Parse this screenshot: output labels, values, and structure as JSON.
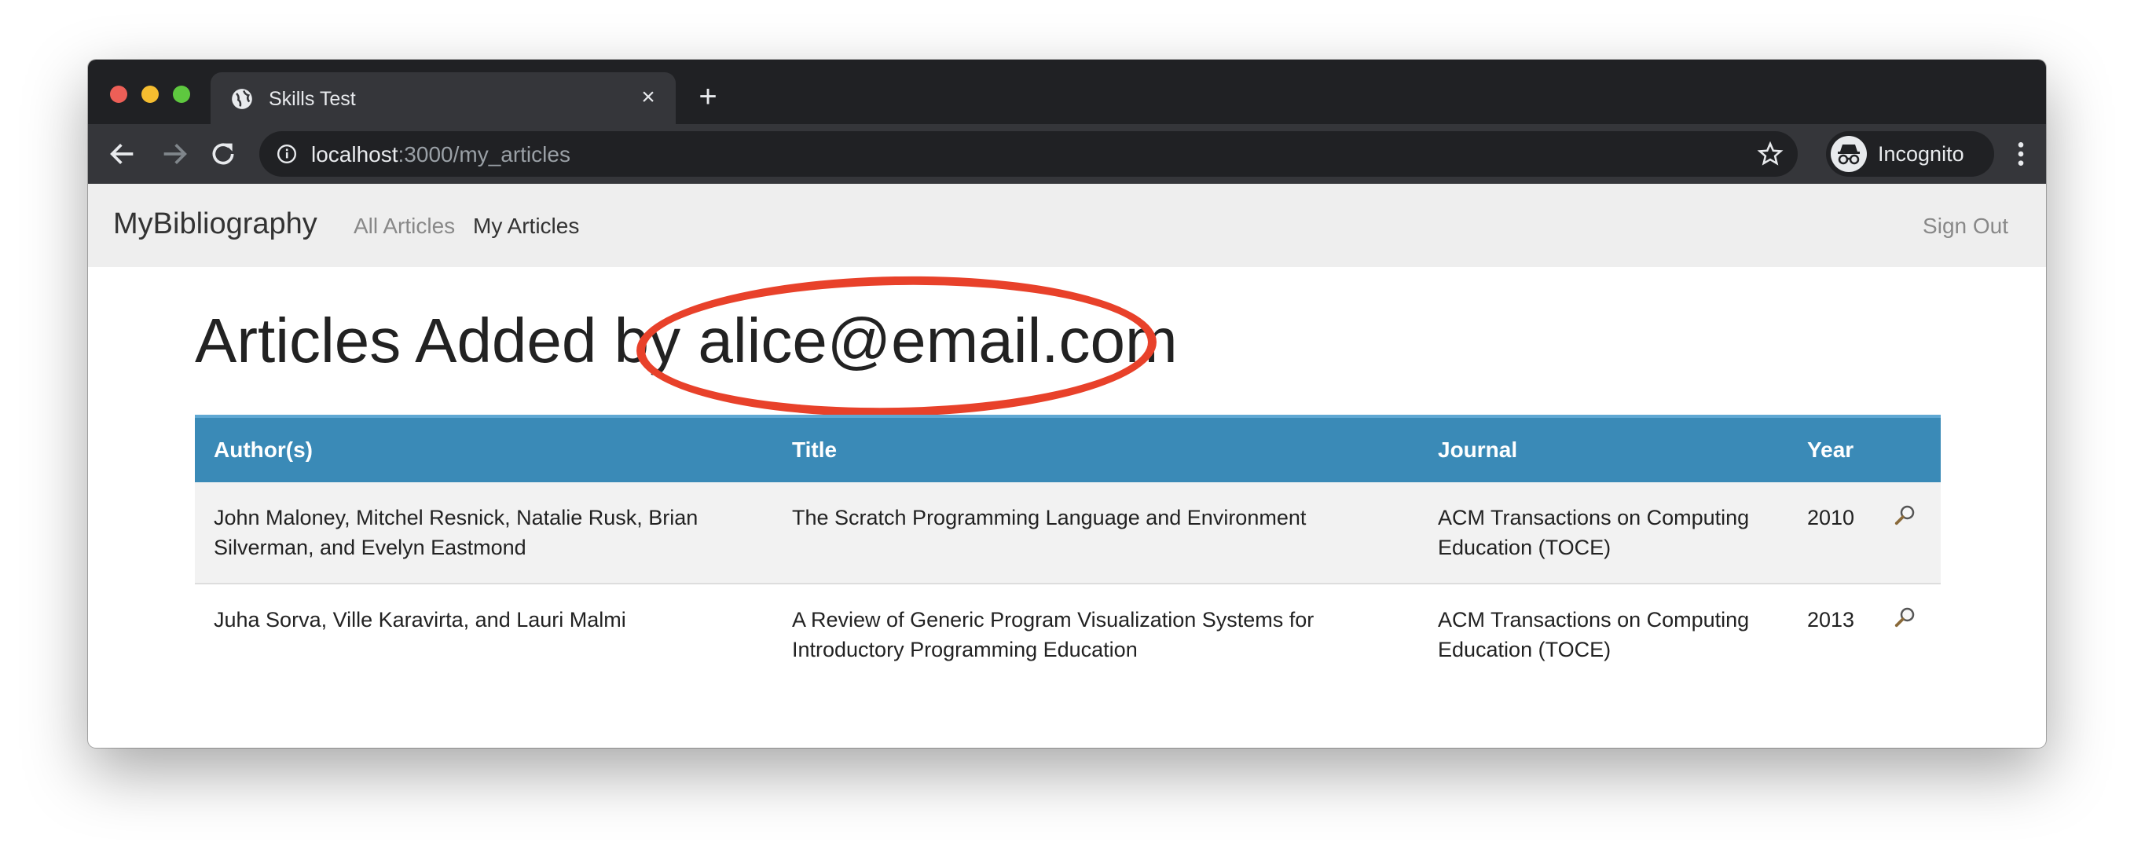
{
  "browser": {
    "tab_title": "Skills Test",
    "url_host": "localhost",
    "url_path": ":3000/my_articles",
    "incognito_label": "Incognito"
  },
  "navbar": {
    "brand": "MyBibliography",
    "links": [
      "All Articles",
      "My Articles"
    ],
    "sign_out": "Sign Out"
  },
  "page": {
    "title_prefix": "Articles Added by ",
    "user_email": "alice@email.com"
  },
  "table": {
    "headers": [
      "Author(s)",
      "Title",
      "Journal",
      "Year"
    ],
    "rows": [
      {
        "authors": "John Maloney, Mitchel Resnick, Natalie Rusk, Brian Silverman, and Evelyn Eastmond",
        "title": "The Scratch Programming Language and Environment",
        "journal": "ACM Transactions on Computing Education (TOCE)",
        "year": "2010"
      },
      {
        "authors": "Juha Sorva, Ville Karavirta, and Lauri Malmi",
        "title": "A Review of Generic Program Visualization Systems for Introductory Programming Education",
        "journal": "ACM Transactions on Computing Education (TOCE)",
        "year": "2013"
      }
    ]
  },
  "colors": {
    "table_header": "#3a8ab7",
    "highlight_ring": "#e8412a",
    "navbar_bg": "#eeeeee"
  },
  "icons": [
    "globe-icon",
    "close-icon",
    "plus-icon",
    "back-arrow-icon",
    "forward-arrow-icon",
    "reload-icon",
    "info-icon",
    "star-icon",
    "incognito-icon",
    "more-vert-icon",
    "magnifier-icon"
  ]
}
